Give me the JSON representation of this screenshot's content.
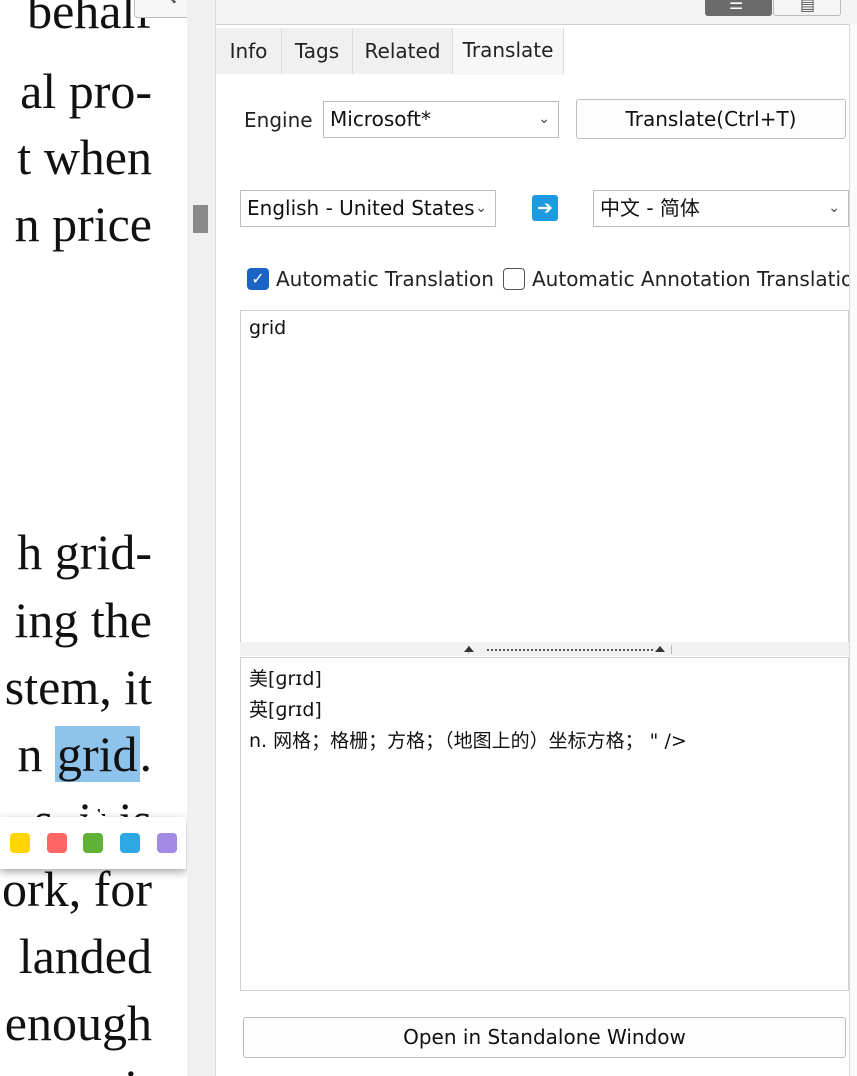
{
  "pdf": {
    "lines": [
      {
        "id": "l0",
        "pre": "behalf",
        "hl": "",
        "post": ""
      },
      {
        "id": "l1",
        "pre": "al pro-",
        "hl": "",
        "post": ""
      },
      {
        "id": "l2",
        "pre": "t when",
        "hl": "",
        "post": ""
      },
      {
        "id": "l3",
        "pre": "n price",
        "hl": "",
        "post": ""
      },
      {
        "id": "l4",
        "pre": "h grid-",
        "hl": "",
        "post": ""
      },
      {
        "id": "l5",
        "pre": "ing the",
        "hl": "",
        "post": ""
      },
      {
        "id": "l6",
        "pre": "stem, it",
        "hl": "",
        "post": ""
      },
      {
        "id": "l7",
        "pre": "n ",
        "hl": "grid",
        "post": "."
      },
      {
        "id": "l8",
        "pre": "s, it is",
        "hl": "",
        "post": ""
      },
      {
        "id": "l9",
        "pre": "ork, for",
        "hl": "",
        "post": ""
      },
      {
        "id": "l10",
        "pre": "landed",
        "hl": "",
        "post": ""
      },
      {
        "id": "l11",
        "pre": "enough",
        "hl": "",
        "post": ""
      },
      {
        "id": "l12",
        "pre": "it",
        "hl": "",
        "post": ""
      }
    ],
    "highlight_colors": [
      "#ffd400",
      "#ff6666",
      "#5fb236",
      "#2ea8e5",
      "#a28ae5"
    ],
    "search_icon": "search-icon"
  },
  "panel": {
    "tabs": [
      {
        "label": "Info"
      },
      {
        "label": "Tags"
      },
      {
        "label": "Related"
      },
      {
        "label": "Translate"
      }
    ],
    "active_tab": "Translate",
    "engine_label": "Engine",
    "engine_value": "Microsoft*",
    "translate_button": "Translate(Ctrl+T)",
    "source_lang": "English - United States",
    "target_lang": "中文 - 简体",
    "auto_translation_label": "Automatic Translation",
    "auto_translation_checked": true,
    "auto_annotation_label": "Automatic Annotation Translation",
    "auto_annotation_checked": false,
    "source_text": "grid",
    "result_lines": [
      "美[ɡrɪd]",
      "英[ɡrɪd]",
      "n. 网格；格栅；方格；（地图上的）坐标方格； \" />"
    ],
    "standalone_button": "Open in Standalone Window",
    "accent_color": "#1c64c4"
  }
}
